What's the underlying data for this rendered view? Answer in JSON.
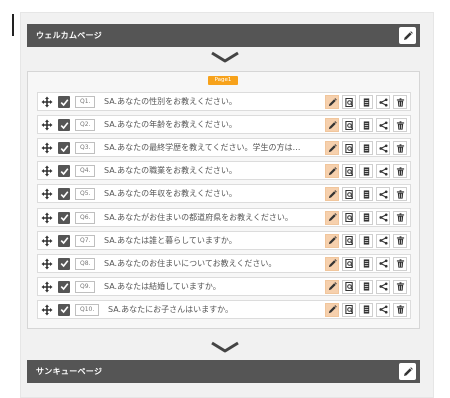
{
  "welcome": {
    "title": "ウェルカムページ",
    "edit_icon": "pencil-icon"
  },
  "page_label": "Page1",
  "questions": [
    {
      "num": "Q1.",
      "text": "SA.あなたの性別をお教えください。"
    },
    {
      "num": "Q2.",
      "text": "SA.あなたの年齢をお教えください。"
    },
    {
      "num": "Q3.",
      "text": "SA.あなたの最終学歴を教えてください。学生の方は…"
    },
    {
      "num": "Q4.",
      "text": "SA.あなたの職業をお教えください。"
    },
    {
      "num": "Q5.",
      "text": "SA.あなたの年収をお教えください。"
    },
    {
      "num": "Q6.",
      "text": "SA.あなたがお住まいの都道府県をお教えください。"
    },
    {
      "num": "Q7.",
      "text": "SA.あなたは誰と暮らしていますか。"
    },
    {
      "num": "Q8.",
      "text": "SA.あなたのお住まいについてお教えください。"
    },
    {
      "num": "Q9.",
      "text": "SA.あなたは結婚していますか。"
    },
    {
      "num": "Q10.",
      "text": "SA.あなたにお子さんはいますか。"
    }
  ],
  "row_action_icons": [
    "pencil-icon",
    "preview-icon",
    "logic-icon",
    "branch-icon",
    "trash-icon"
  ],
  "thanks": {
    "title": "サンキューページ",
    "edit_icon": "pencil-icon"
  },
  "colors": {
    "header_bg": "#555555",
    "badge": "#f7a21b",
    "edit_active": "#f6d0ad"
  }
}
